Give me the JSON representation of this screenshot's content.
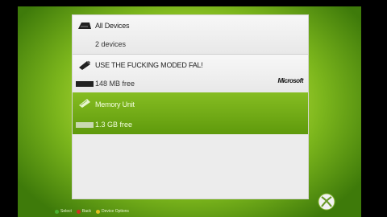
{
  "devices": [
    {
      "title": "All Devices",
      "subtitle": "2 devices",
      "icon": "all-devices-icon",
      "selected": false
    },
    {
      "title": "USE THE FUCKING MODED FAL!",
      "subtitle": "148 MB free",
      "icon": "usb-drive-icon",
      "selected": false,
      "brand": "Microsoft"
    },
    {
      "title": "Memory Unit",
      "subtitle": "1.3 GB free",
      "icon": "memory-unit-icon",
      "selected": true
    }
  ],
  "footer": {
    "select": "Select",
    "back": "Back",
    "options": "Device Options"
  },
  "colors": {
    "accent": "#6aa412",
    "button_a": "#4caf30",
    "button_b": "#d03020",
    "button_y": "#e0c020"
  }
}
